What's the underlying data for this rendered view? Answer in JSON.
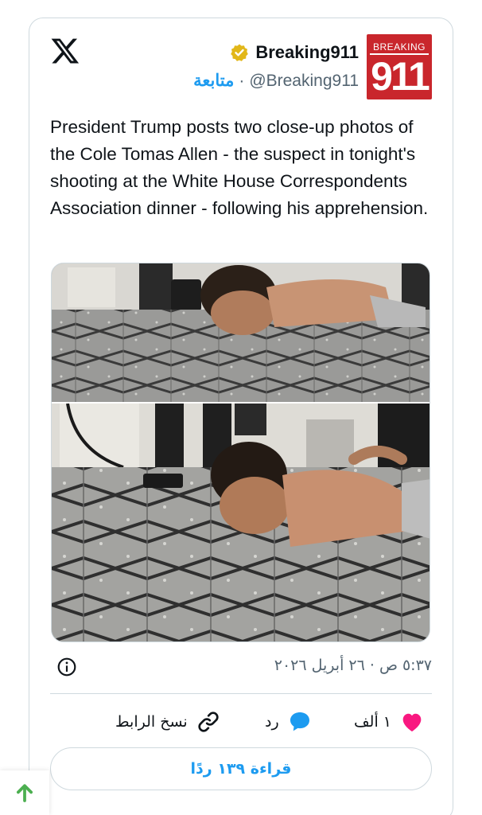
{
  "author": {
    "display_name": "Breaking911",
    "handle": "@Breaking911",
    "separator": "·",
    "follow_label": "متابعة",
    "avatar_top_text": "BREAKING",
    "avatar_number": "911"
  },
  "tweet": {
    "text": "President Trump posts two close-up photos of the Cole Tomas Allen - the suspect in tonight's shooting at the White House Correspondents Association dinner - following his apprehension.",
    "timestamp": "٥:٣٧ ص · ٢٦ أبريل ٢٠٢٦"
  },
  "actions": {
    "like_count": "١ ألف",
    "reply_label": "رد",
    "copy_link_label": "نسخ الرابط"
  },
  "replies_button": {
    "label": "قراءة ١٣٩ ردًا"
  },
  "icons": {
    "logo": "x-logo-icon",
    "verified": "verified-badge-icon",
    "info": "info-icon",
    "like": "heart-icon",
    "reply": "speech-bubble-icon",
    "copy_link": "link-icon",
    "scroll_top": "arrow-up-icon"
  },
  "colors": {
    "accent": "#1d9bf0",
    "like": "#f91880",
    "verified_gold": "#e2b719",
    "avatar_red": "#c9262c",
    "scroll_arrow": "#4caf50"
  }
}
